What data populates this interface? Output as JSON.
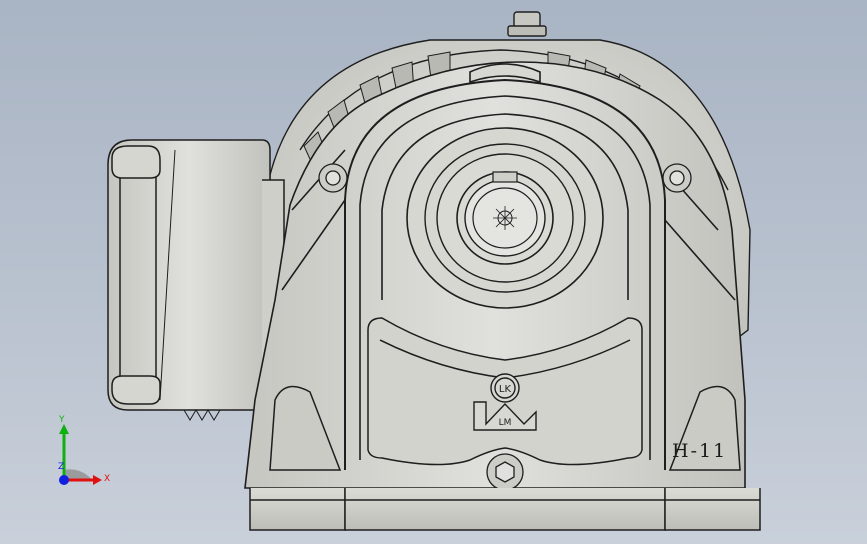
{
  "app": {
    "viewport_name": "3D model viewport",
    "background_colors": [
      "#a9b4c4",
      "#c9d0da"
    ]
  },
  "model": {
    "part_label": "H-11",
    "logo_letters": "LK",
    "logo_monogram": "LM",
    "body_color": "#d4d4cf",
    "edge_color": "#1e1e1e"
  },
  "triad": {
    "x_label": "X",
    "y_label": "Y",
    "z_label": "Z",
    "x_color": "#e01010",
    "y_color": "#10b010",
    "z_color": "#1020e0"
  }
}
